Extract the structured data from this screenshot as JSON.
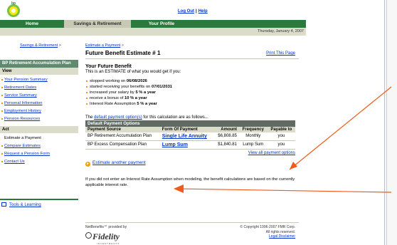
{
  "header": {
    "logo_text": "bp",
    "logout": "Log Out",
    "separator": "|",
    "help": "Help"
  },
  "nav": {
    "tabs": [
      "Home",
      "Savings & Retirement",
      "Your Profile"
    ]
  },
  "date": "Thursday, January 4, 2007",
  "breadcrumb_left": {
    "link": "Savings & Retirement",
    "sep": ">"
  },
  "sidebar": {
    "title": "BP Retirement Accumulation Plan",
    "view_label": "View",
    "view_items": [
      "Your Pension Summary",
      "Retirement Dates",
      "Service Summary",
      "Personal Information",
      "Employment History",
      "Pension Resources"
    ],
    "act_label": "Act",
    "act_current": "Estimate a Payment",
    "act_items": [
      "Compare Estimates",
      "Request a Pension Form",
      "Contact Us"
    ],
    "tools": "Tools & Learning"
  },
  "main": {
    "crumb_link": "Estimate a Payment",
    "crumb_sep": ">",
    "title": "Future Benefit Estimate # 1",
    "print": "Print This Page",
    "future_head": "Your Future Benefit",
    "future_sub": "This is an ESTIMATE of what you would get if you:",
    "assumptions": [
      {
        "pre": "stopped working on ",
        "bold": "06/08/2026",
        "post": ""
      },
      {
        "pre": "started receiving your benefits on ",
        "bold": "07/01/2031",
        "post": ""
      },
      {
        "pre": "increased your salary by ",
        "bold": "5 % a year",
        "post": ""
      },
      {
        "pre": "receive a bonus of ",
        "bold": "10 % a year",
        "post": ""
      },
      {
        "pre": "Interest Rate Assumption ",
        "bold": "5 % a year",
        "post": ""
      }
    ],
    "default_pre": "The ",
    "default_link": "default payment option(s)",
    "default_post": " for this calculation are as follows...",
    "table": {
      "caption": "Default Payment Options",
      "headers": [
        "Payment Source",
        "Form Of Payment",
        "Amount",
        "Frequency",
        "Payable to"
      ],
      "rows": [
        {
          "source": "BP Retirement Accumulation Plan",
          "form": "Single Life Annuity",
          "amount": "$6,808.85",
          "freq": "Monthly",
          "payable": "you"
        },
        {
          "source": "BP Excess Compensation Plan",
          "form": "Lump Sum",
          "amount": "$1,840.81",
          "freq": "Lump Sum",
          "payable": "you"
        }
      ]
    },
    "view_all": "View all payment options",
    "estimate_another": "Estimate another payment",
    "note": "If you did not enter an Interest Rate Assumption when modeling, the benefit calculations are based on the currently applicable interest rate."
  },
  "footer": {
    "provided": "NetBenefits℠ provided by",
    "brand": "Fidelity",
    "brand_sub": "INVESTMENTS",
    "copyright": "© Copyright 1996-2007 FMR Corp.",
    "rights": "All rights reserved.",
    "legal": "Legal Disclaimer"
  },
  "colors": {
    "nav_green": "#2b7a3d",
    "accent_orange": "#f05a1a",
    "link_blue": "#0033cc"
  }
}
